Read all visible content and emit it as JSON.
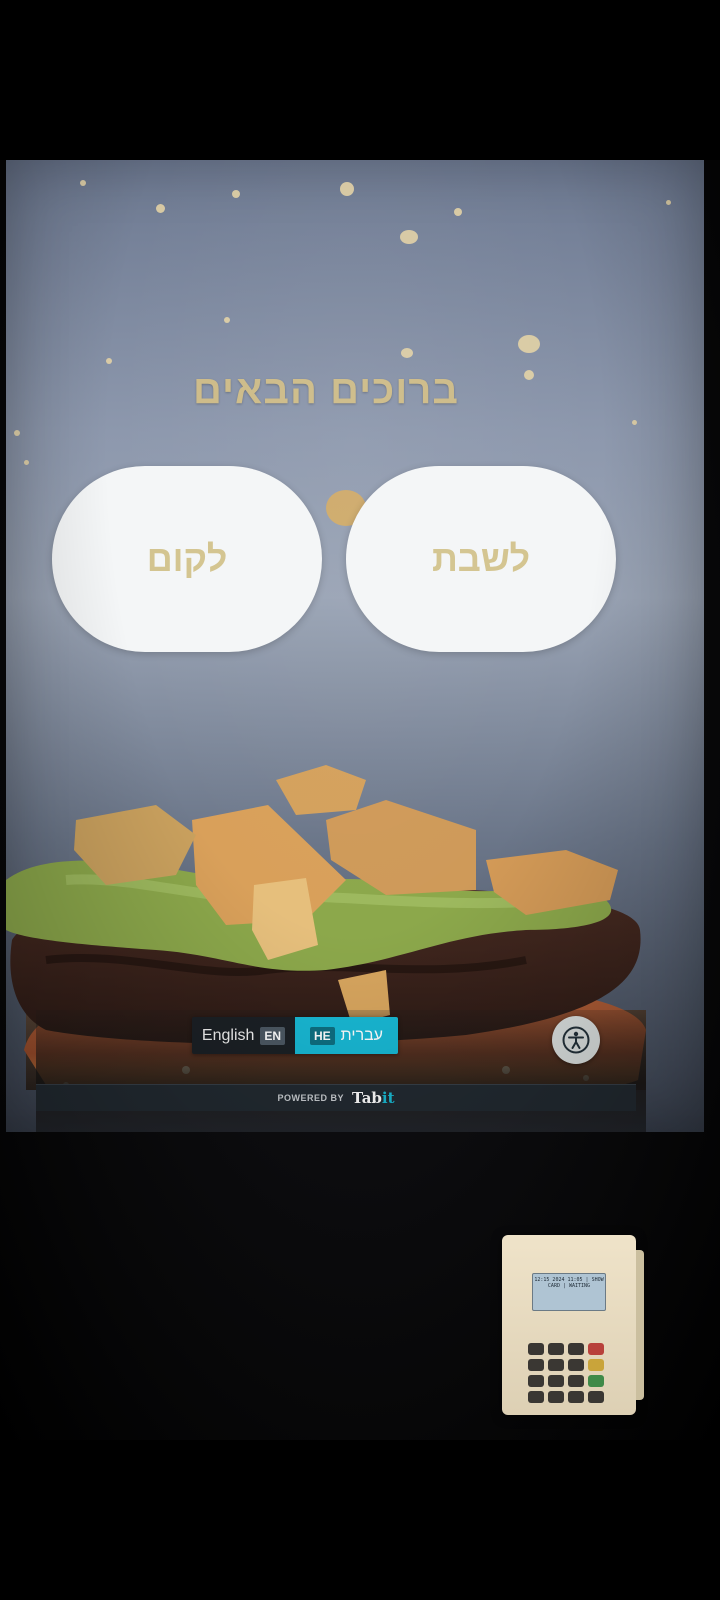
{
  "screen": {
    "welcome_title": "ברוכים הבאים",
    "options": {
      "takeaway": "לקום",
      "dine_in": "לשבת"
    },
    "language": {
      "english_label": "English",
      "english_code": "EN",
      "hebrew_label": "עברית",
      "hebrew_code": "HE",
      "selected": "HE"
    },
    "accessibility_icon": "accessibility-icon",
    "footer": {
      "powered_by": "POWERED BY",
      "brand_main": "Tab",
      "brand_accent": "it"
    }
  },
  "colors": {
    "title_gold": "#cdbb88",
    "button_bg": "#f4f6f7",
    "hebrew_accent": "#18b8d4",
    "footer_bg": "#222a31"
  },
  "card_terminal": {
    "display_text": "12:15 2024 11:05 | SHOW CARD | WAITING"
  }
}
